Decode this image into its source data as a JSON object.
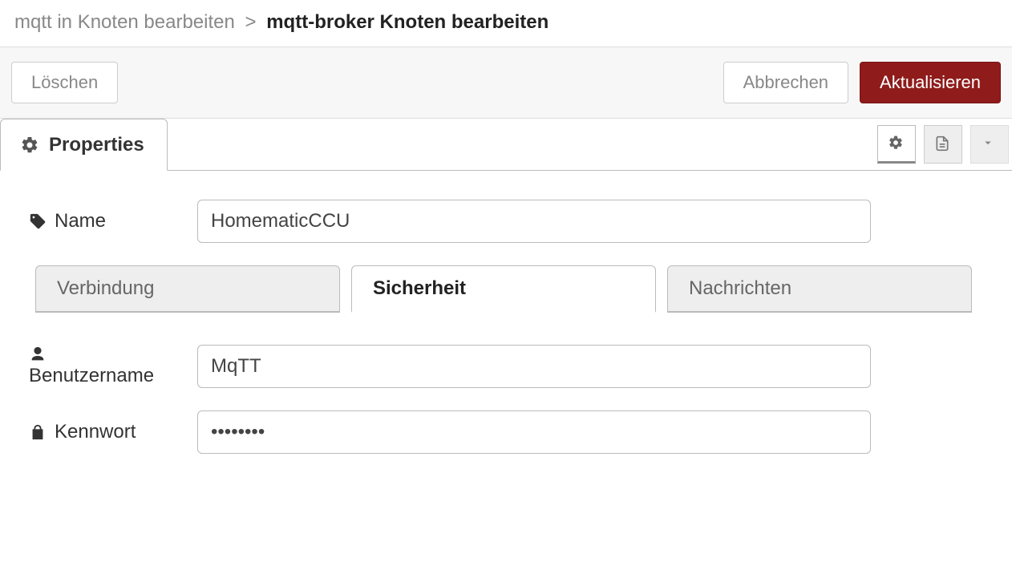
{
  "breadcrumb": {
    "parent": "mqtt in Knoten bearbeiten",
    "separator": ">",
    "current": "mqtt-broker Knoten bearbeiten"
  },
  "toolbar": {
    "delete_label": "Löschen",
    "cancel_label": "Abbrechen",
    "update_label": "Aktualisieren"
  },
  "maintab": {
    "label": "Properties"
  },
  "form": {
    "name_label": "Name",
    "name_value": "HomematicCCU",
    "username_label": "Benutzername",
    "username_value": "MqTT",
    "password_label": "Kennwort",
    "password_value": "••••••••"
  },
  "subtabs": {
    "connection": "Verbindung",
    "security": "Sicherheit",
    "messages": "Nachrichten"
  }
}
